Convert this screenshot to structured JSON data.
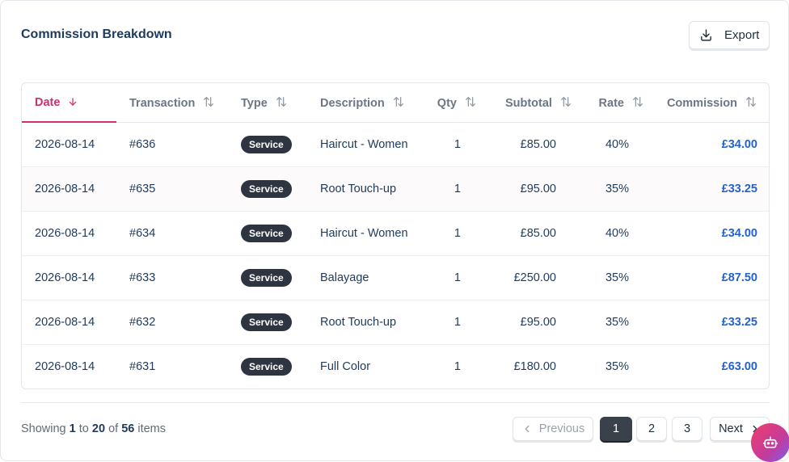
{
  "header": {
    "title": "Commission Breakdown",
    "export_label": "Export"
  },
  "table": {
    "columns": {
      "date": "Date",
      "transaction": "Transaction",
      "type": "Type",
      "description": "Description",
      "qty": "Qty",
      "subtotal": "Subtotal",
      "rate": "Rate",
      "commission": "Commission"
    },
    "rows": [
      {
        "date": "2026-08-14",
        "transaction": "#636",
        "type": "Service",
        "description": "Haircut - Women",
        "qty": "1",
        "subtotal": "£85.00",
        "rate": "40%",
        "commission": "£34.00"
      },
      {
        "date": "2026-08-14",
        "transaction": "#635",
        "type": "Service",
        "description": "Root Touch-up",
        "qty": "1",
        "subtotal": "£95.00",
        "rate": "35%",
        "commission": "£33.25"
      },
      {
        "date": "2026-08-14",
        "transaction": "#634",
        "type": "Service",
        "description": "Haircut - Women",
        "qty": "1",
        "subtotal": "£85.00",
        "rate": "40%",
        "commission": "£34.00"
      },
      {
        "date": "2026-08-14",
        "transaction": "#633",
        "type": "Service",
        "description": "Balayage",
        "qty": "1",
        "subtotal": "£250.00",
        "rate": "35%",
        "commission": "£87.50"
      },
      {
        "date": "2026-08-14",
        "transaction": "#632",
        "type": "Service",
        "description": "Root Touch-up",
        "qty": "1",
        "subtotal": "£95.00",
        "rate": "35%",
        "commission": "£33.25"
      },
      {
        "date": "2026-08-14",
        "transaction": "#631",
        "type": "Service",
        "description": "Full Color",
        "qty": "1",
        "subtotal": "£180.00",
        "rate": "35%",
        "commission": "£63.00"
      }
    ]
  },
  "footer": {
    "summary_prefix": "Showing",
    "from": "1",
    "to_word": "to",
    "to": "20",
    "of_word": "of",
    "total": "56",
    "items_word": "items"
  },
  "pagination": {
    "previous": "Previous",
    "next": "Next",
    "pages": [
      "1",
      "2",
      "3"
    ],
    "current": "1"
  },
  "colors": {
    "accent": "#d0306f",
    "commission": "#2563c9",
    "badge": "#2f3540"
  },
  "icons": {
    "export": "download-icon",
    "sort": "sort-arrows-icon",
    "sort_active": "arrow-down-icon",
    "fab": "robot-icon"
  }
}
